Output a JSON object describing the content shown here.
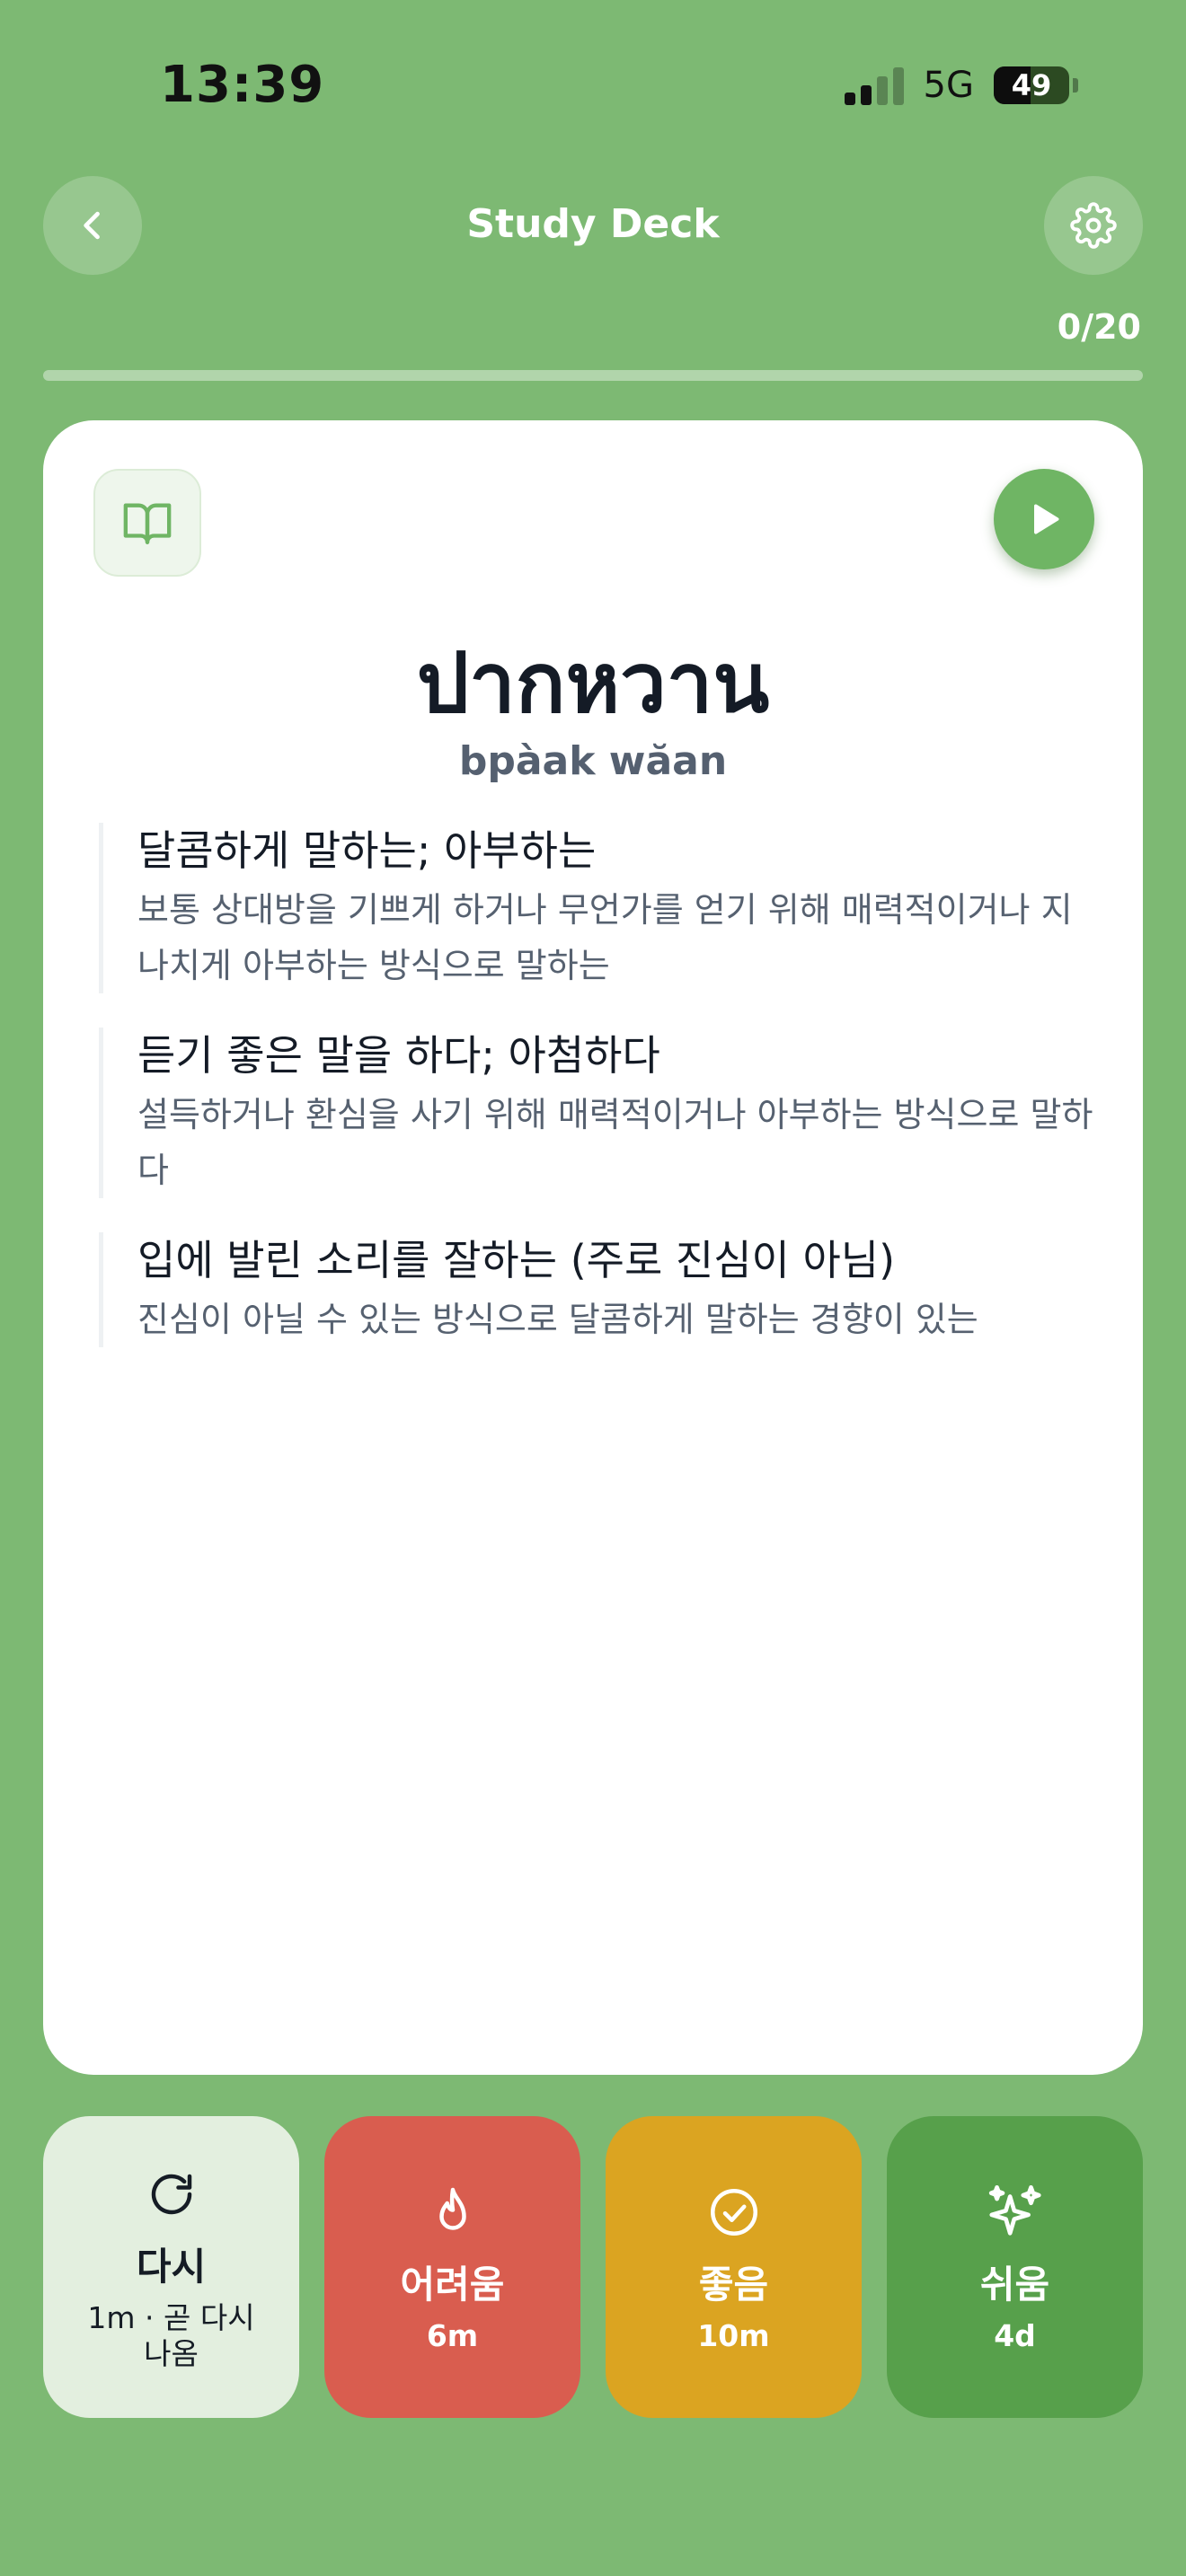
{
  "status_bar": {
    "time": "13:39",
    "network": "5G",
    "battery": "49"
  },
  "header": {
    "title": "Study Deck"
  },
  "progress": {
    "label": "0/20",
    "fraction": 0
  },
  "card": {
    "word": "ปากหวาน",
    "romanization": "bpàak wăan",
    "definitions": [
      {
        "title": "달콤하게 말하는; 아부하는",
        "description": "보통 상대방을 기쁘게 하거나 무언가를 얻기 위해 매력적이거나 지나치게 아부하는 방식으로 말하는"
      },
      {
        "title": "듣기 좋은 말을 하다; 아첨하다",
        "description": "설득하거나 환심을 사기 위해 매력적이거나 아부하는 방식으로 말하다"
      },
      {
        "title": "입에 발린 소리를 잘하는 (주로 진심이 아님)",
        "description": "진심이 아닐 수 있는 방식으로 달콤하게 말하는 경향이 있는"
      }
    ]
  },
  "answers": [
    {
      "label": "다시",
      "interval": "1m · 곧 다시 나옴",
      "icon": "refresh-icon",
      "color": "#e3efdf"
    },
    {
      "label": "어려움",
      "interval": "6m",
      "icon": "flame-icon",
      "color": "#d95d4f"
    },
    {
      "label": "좋음",
      "interval": "10m",
      "icon": "check-circle-icon",
      "color": "#dba421"
    },
    {
      "label": "쉬움",
      "interval": "4d",
      "icon": "sparkles-icon",
      "color": "#57a04b"
    }
  ],
  "colors": {
    "background": "#7db973",
    "accent": "#6fb564"
  }
}
